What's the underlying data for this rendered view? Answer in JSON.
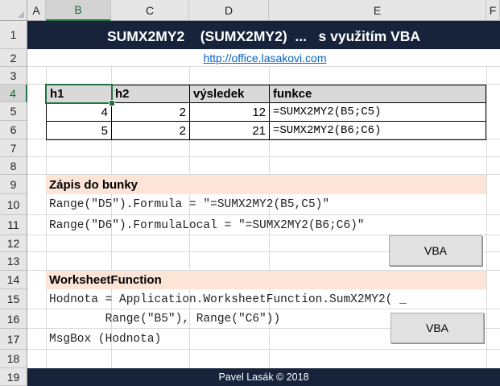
{
  "columns": [
    "A",
    "B",
    "C",
    "D",
    "E",
    "F"
  ],
  "rows": [
    "1",
    "2",
    "3",
    "4",
    "5",
    "6",
    "7",
    "8",
    "9",
    "10",
    "11",
    "12",
    "13",
    "14",
    "15",
    "16",
    "17",
    "18",
    "19"
  ],
  "selected_cell": "B4",
  "title": "SUMX2MY2    (SUMX2MY2)  ...   s využitím VBA",
  "link": "http://office.lasakovi.com",
  "table": {
    "headers": [
      "h1",
      "h2",
      "výsledek",
      "funkce"
    ],
    "rows": [
      {
        "h1": "4",
        "h2": "2",
        "result": "12",
        "formula": "=SUMX2MY2(B5;C5)"
      },
      {
        "h1": "5",
        "h2": "2",
        "result": "21",
        "formula": "=SUMX2MY2(B6;C6)"
      }
    ]
  },
  "section1": {
    "title": "Zápis do bunky",
    "line1": "Range(\"D5\").Formula = \"=SUMX2MY2(B5,C5)\"",
    "line2": "Range(\"D6\").FormulaLocal = \"=SUMX2MY2(B6;C6)\"",
    "button": "VBA"
  },
  "section2": {
    "title": "WorksheetFunction",
    "line1": "Hodnota = Application.WorksheetFunction.SumX2MY2( _",
    "line2": "        Range(\"B5\"), Range(\"C6\"))",
    "line3": "MsgBox (Hodnota)",
    "button": "VBA"
  },
  "footer": "Pavel Lasák © 2018",
  "colors": {
    "dark_band": "#17223b",
    "peach_band": "#fce4d6",
    "header_fill": "#d9d9d9",
    "selection": "#217346",
    "link": "#0563c1"
  }
}
